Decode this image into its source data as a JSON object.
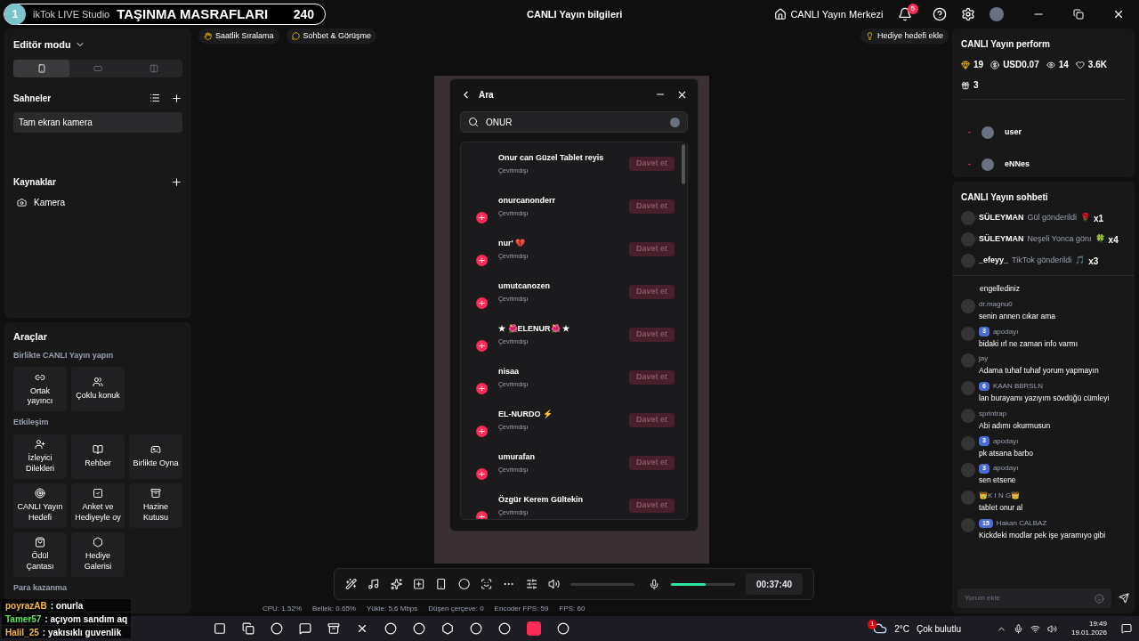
{
  "overlay_bar": {
    "number": "1",
    "app_name": "ikTok LIVE Studio",
    "title": "TAŞINMA MASRAFLARI",
    "count": "240"
  },
  "header": {
    "center_title": "CANLI Yayın bilgileri",
    "center_button": "CANLI Yayın Merkezi",
    "notifications": "5"
  },
  "top_chips": [
    {
      "kind": "hand",
      "label": "Saatlik Sıralama"
    },
    {
      "kind": "chat",
      "label": "Sohbet & Görüşme"
    }
  ],
  "goal_chip": "Hediye hedefi ekle",
  "editor": {
    "title": "Editör modu",
    "orientations": [
      {
        "kind": "portrait",
        "selected": true
      },
      {
        "kind": "landscape",
        "selected": false
      },
      {
        "kind": "split",
        "selected": false
      }
    ],
    "scenes_title": "Sahneler",
    "scenes": [
      {
        "label": "Tam ekran kamera",
        "selected": true
      }
    ],
    "sources_title": "Kaynaklar",
    "sources": [
      {
        "kind": "camera",
        "label": "Kamera"
      }
    ]
  },
  "tools": {
    "title": "Araçlar",
    "sections": [
      {
        "title": "Birlikte CANLI Yayın yapın",
        "items": [
          {
            "kind": "link",
            "label": "Ortak yayıncı"
          },
          {
            "kind": "users",
            "label": "Çoklu konuk"
          }
        ]
      },
      {
        "title": "Etkileşim",
        "items": [
          {
            "kind": "wish",
            "label": "İzleyici Dilekleri"
          },
          {
            "kind": "book",
            "label": "Rehber"
          },
          {
            "kind": "game",
            "label": "Birlikte Oyna"
          },
          {
            "kind": "target",
            "label": "CANLI Yayın Hedefi"
          },
          {
            "kind": "poll",
            "label": "Anket ve Hediyeyle oy"
          },
          {
            "kind": "chest",
            "label": "Hazine Kutusu"
          },
          {
            "kind": "bag",
            "label": "Ödül Çantası"
          },
          {
            "kind": "gallery",
            "label": "Hediye Galerisi"
          }
        ]
      },
      {
        "title": "Para kazanma"
      }
    ]
  },
  "stream_chat_overlay": [
    {
      "user": "poyrazAB",
      "text": ": onurla",
      "color": "#f5b942"
    },
    {
      "user": "Tamer57",
      "text": ": açıyom sandım aq",
      "color": "#5fe35f"
    },
    {
      "user": "Halil_25",
      "text": ": yakısıklı guvenlik",
      "color": "#f5b942"
    }
  ],
  "search_dialog": {
    "title": "Ara",
    "query": "ONUR",
    "results": [
      {
        "name": "Onur can Güzel Tablet reyis",
        "status": "Çevrimdışı",
        "button": "Davet et",
        "add_button": false
      },
      {
        "name": "onurcanonderr",
        "status": "Çevrimdışı",
        "button": "Davet et",
        "add_button": true
      },
      {
        "name": "nur' 💔",
        "status": "Çevrimdışı",
        "button": "Davet et",
        "add_button": true
      },
      {
        "name": "umutcanozen",
        "status": "Çevrimdışı",
        "button": "Davet et",
        "add_button": true
      },
      {
        "name": "★ 🌺ELENUR🌺 ★",
        "status": "Çevrimdışı",
        "button": "Davet et",
        "add_button": true
      },
      {
        "name": "nisaa",
        "status": "Çevrimdışı",
        "button": "Davet et",
        "add_button": true
      },
      {
        "name": "EL-NURDO ⚡",
        "status": "Çevrimdışı",
        "button": "Davet et",
        "add_button": true
      },
      {
        "name": "umurafan",
        "status": "Çevrimdışı",
        "button": "Davet et",
        "add_button": true
      },
      {
        "name": "Özgür Kerem Gültekin",
        "status": "Çevrimdışı",
        "button": "Davet et",
        "add_button": true
      }
    ]
  },
  "control_bar": {
    "volume": {
      "level": 0
    },
    "mic": {
      "level": 0.55
    },
    "timer": "00:37:40"
  },
  "stats": [
    "CPU: 1.52%",
    "Bellek: 0.65%",
    "Yükle: 5.6 Mbps",
    "Düşen çerçeve: 0",
    "Encoder FPS: 59",
    "FPS: 60"
  ],
  "performance": {
    "title": "CANLI Yayın perform",
    "metrics": [
      {
        "kind": "diamond",
        "value": "19"
      },
      {
        "kind": "dollar",
        "value": "USD0.07"
      },
      {
        "kind": "viewers",
        "value": "14"
      },
      {
        "kind": "heart",
        "value": "3.6K"
      },
      {
        "kind": "gift",
        "value": "3"
      }
    ],
    "ranking": [
      {
        "rank": "-",
        "name": "user"
      },
      {
        "rank": "-",
        "name": "eNNes"
      }
    ]
  },
  "live_chat": {
    "title": "CANLI Yayın sohbeti",
    "gifts": [
      {
        "user": "SÜLEYMAN",
        "text": "Gül gönderildi",
        "gift": "🌹",
        "count": "x1"
      },
      {
        "user": "SÜLEYMAN",
        "text": "Neşeli Yonca gönı",
        "gift": "🍀",
        "count": "x4"
      },
      {
        "user": "_efeyy_",
        "text": "TikTok gönderildi",
        "gift": "🎵",
        "count": "x3"
      }
    ],
    "messages": [
      {
        "kind": "system",
        "text": "engellediniz"
      },
      {
        "kind": "message",
        "user": "dr.magnu0",
        "text": "senin annen cıkar ama"
      },
      {
        "kind": "message",
        "badge": "3",
        "user": "apodayı",
        "text": "bidaki ırl ne zaman info varmı"
      },
      {
        "kind": "message",
        "user": "jay",
        "text": "Adama tuhaf tuhaf yorum yapmayın"
      },
      {
        "kind": "message",
        "badge": "6",
        "user": "KAAN BBRSLN",
        "text": "lan burayamı yazıyım sövdüğü cümleyi"
      },
      {
        "kind": "message",
        "user": "sprintrap",
        "text": "Abi adımı okurmusun"
      },
      {
        "kind": "message",
        "badge": "3",
        "user": "apodayı",
        "text": "pk atsana barbo"
      },
      {
        "kind": "message",
        "badge": "3",
        "user": "apodayı",
        "text": "sen etsene"
      },
      {
        "kind": "message",
        "user": "👑K I N G👑",
        "text": "tablet onur al"
      },
      {
        "kind": "message",
        "badge": "15",
        "user": "Hakan CALBAZ",
        "text": "Kickdeki modlar pek işe yaramıyo gibi"
      }
    ],
    "input_placeholder": "Yorum ekle"
  },
  "taskbar": {
    "weather_alert": "1",
    "temperature": "2°C",
    "weather": "Çok bulutlu",
    "time": "19:49",
    "date": "19.01.2026"
  }
}
